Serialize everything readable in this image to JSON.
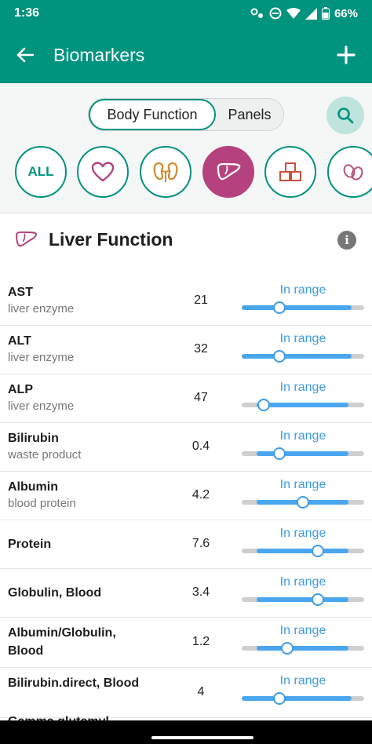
{
  "status_bar": {
    "time": "1:36",
    "battery": "66%"
  },
  "app_bar": {
    "title": "Biomarkers"
  },
  "segmented": {
    "options": [
      "Body Function",
      "Panels"
    ],
    "selected": "Body Function"
  },
  "categories": [
    {
      "id": "all",
      "label": "ALL",
      "icon": "all-text"
    },
    {
      "id": "heart",
      "icon": "heart-icon"
    },
    {
      "id": "kidney",
      "icon": "kidney-icon"
    },
    {
      "id": "liver",
      "icon": "liver-icon",
      "active": true
    },
    {
      "id": "metabolism",
      "icon": "cubes-icon"
    },
    {
      "id": "digestion",
      "icon": "beans-icon"
    }
  ],
  "section": {
    "title": "Liver Function",
    "icon": "liver-icon"
  },
  "colors": {
    "primary": "#00937e",
    "liver_accent": "#b5427e",
    "range_blue": "#4aa6ef"
  },
  "biomarkers": [
    {
      "name": "AST",
      "subtitle": "liver enzyme",
      "value": "21",
      "status": "In range",
      "range_start": 0,
      "range_end": 0.9,
      "marker": 0.31
    },
    {
      "name": "ALT",
      "subtitle": "liver enzyme",
      "value": "32",
      "status": "In range",
      "range_start": 0,
      "range_end": 0.9,
      "marker": 0.31
    },
    {
      "name": "ALP",
      "subtitle": "liver enzyme",
      "value": "47",
      "status": "In range",
      "range_start": 0.12,
      "range_end": 0.87,
      "marker": 0.18
    },
    {
      "name": "Bilirubin",
      "subtitle": "waste product",
      "value": "0.4",
      "status": "In range",
      "range_start": 0.12,
      "range_end": 0.87,
      "marker": 0.31
    },
    {
      "name": "Albumin",
      "subtitle": "blood protein",
      "value": "4.2",
      "status": "In range",
      "range_start": 0.12,
      "range_end": 0.87,
      "marker": 0.5
    },
    {
      "name": "Protein",
      "subtitle": "",
      "value": "7.6",
      "status": "In range",
      "range_start": 0.12,
      "range_end": 0.87,
      "marker": 0.62
    },
    {
      "name": "Globulin, Blood",
      "subtitle": "",
      "value": "3.4",
      "status": "In range",
      "range_start": 0.12,
      "range_end": 0.87,
      "marker": 0.62
    },
    {
      "name": "Albumin/Globulin, Blood",
      "subtitle": "",
      "value": "1.2",
      "status": "In range",
      "range_start": 0.12,
      "range_end": 0.87,
      "marker": 0.37
    },
    {
      "name": "Bilirubin.direct, Blood",
      "subtitle": "",
      "value": "4",
      "status": "In range",
      "range_start": 0,
      "range_end": 0.9,
      "marker": 0.31
    }
  ],
  "peek_row": {
    "name": "Gamma glutamyl"
  }
}
